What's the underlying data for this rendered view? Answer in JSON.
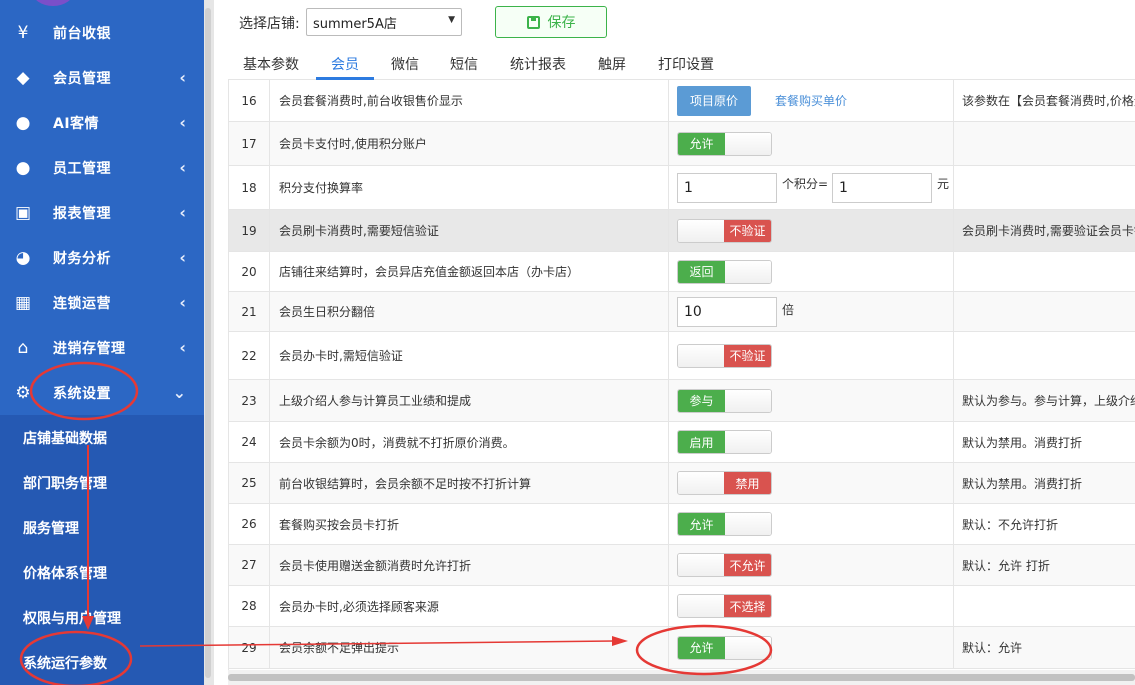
{
  "sidebar": {
    "items": [
      {
        "label": "前台收银",
        "icon": "yen-icon",
        "glyph": "¥",
        "chevron": ""
      },
      {
        "label": "会员管理",
        "icon": "diamond-icon",
        "glyph": "◆",
        "chevron": "‹"
      },
      {
        "label": "AI客情",
        "icon": "user-check-icon",
        "glyph": "●",
        "chevron": "‹"
      },
      {
        "label": "员工管理",
        "icon": "user-icon",
        "glyph": "●",
        "chevron": "‹"
      },
      {
        "label": "报表管理",
        "icon": "monitor-icon",
        "glyph": "▣",
        "chevron": "‹"
      },
      {
        "label": "财务分析",
        "icon": "pie-chart-icon",
        "glyph": "◕",
        "chevron": "‹"
      },
      {
        "label": "连锁运营",
        "icon": "building-icon",
        "glyph": "▦",
        "chevron": "‹"
      },
      {
        "label": "进销存管理",
        "icon": "home-icon",
        "glyph": "⌂",
        "chevron": "‹"
      },
      {
        "label": "系统设置",
        "icon": "gear-icon",
        "glyph": "⚙",
        "chevron": "⌄"
      }
    ],
    "subitems": [
      "店铺基础数据",
      "部门职务管理",
      "服务管理",
      "价格体系管理",
      "权限与用户管理",
      "系统运行参数"
    ]
  },
  "header": {
    "store_label": "选择店铺:",
    "store_value": "summer5A店",
    "save_label": "保存"
  },
  "tabs": [
    "基本参数",
    "会员",
    "微信",
    "短信",
    "统计报表",
    "触屏",
    "打印设置"
  ],
  "active_tab": "会员",
  "rows": [
    {
      "no": "16",
      "name": "会员套餐消费时,前台收银售价显示",
      "btn": "项目原价",
      "link": "套餐购买单价",
      "note": "该参数在【会员套餐消费时,价格无"
    },
    {
      "no": "17",
      "name": "会员卡支付时,使用积分账户",
      "toggle_on": "允许",
      "note": ""
    },
    {
      "no": "18",
      "name": "积分支付换算率",
      "input1": "1",
      "mid": "个积分=",
      "input2": "1",
      "unit": "元",
      "note": ""
    },
    {
      "no": "19",
      "name": "会员刷卡消费时,需要短信验证",
      "toggle_off": "不验证",
      "note": "会员刷卡消费时,需要验证会员卡钱"
    },
    {
      "no": "20",
      "name": "店铺往来结算时，会员异店充值金额返回本店（办卡店）",
      "toggle_on": "返回",
      "note": ""
    },
    {
      "no": "21",
      "name": "会员生日积分翻倍",
      "input1": "10",
      "unit": "倍",
      "note": ""
    },
    {
      "no": "22",
      "name": "会员办卡时,需短信验证",
      "toggle_off": "不验证",
      "note": ""
    },
    {
      "no": "23",
      "name": "上级介绍人参与计算员工业绩和提成",
      "toggle_on": "参与",
      "note": "默认为参与。参与计算，上级介绍"
    },
    {
      "no": "24",
      "name": "会员卡余额为0时，消费就不打折原价消费。",
      "toggle_on": "启用",
      "note": "默认为禁用。消费打折"
    },
    {
      "no": "25",
      "name": "前台收银结算时，会员余额不足时按不打折计算",
      "toggle_off": "禁用",
      "note": "默认为禁用。消费打折"
    },
    {
      "no": "26",
      "name": "套餐购买按会员卡打折",
      "toggle_on": "允许",
      "note": "默认：不允许打折"
    },
    {
      "no": "27",
      "name": "会员卡使用赠送金额消费时允许打折",
      "toggle_off": "不允许",
      "note": "默认：允许 打折"
    },
    {
      "no": "28",
      "name": "会员办卡时,必须选择顾客来源",
      "toggle_off": "不选择",
      "note": ""
    },
    {
      "no": "29",
      "name": "会员余额不足弹出提示",
      "toggle_on": "允许",
      "note": "默认：允许"
    }
  ],
  "colors": {
    "sidebar": "#2c67c4",
    "submenu": "#2559b3",
    "accent": "#2d7be0",
    "on": "#4cae4c",
    "off": "#d9534f",
    "annotation": "#e53935"
  }
}
